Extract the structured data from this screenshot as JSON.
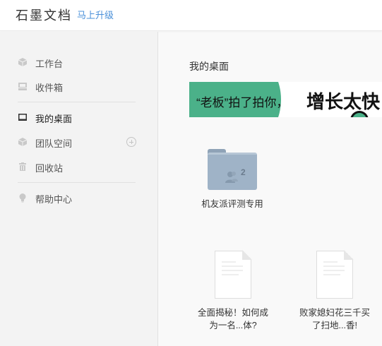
{
  "header": {
    "brand": "石墨文档",
    "upgrade_link": "马上升级"
  },
  "sidebar": {
    "items": [
      {
        "label": "工作台",
        "icon": "cube-icon"
      },
      {
        "label": "收件箱",
        "icon": "inbox-icon"
      },
      {
        "label": "我的桌面",
        "icon": "desktop-icon"
      },
      {
        "label": "团队空间",
        "icon": "team-cube-icon"
      },
      {
        "label": "回收站",
        "icon": "trash-icon"
      },
      {
        "label": "帮助中心",
        "icon": "lightbulb-icon"
      }
    ],
    "active": "我的桌面"
  },
  "main": {
    "title": "我的桌面",
    "banner": {
      "text_left": "“老板”拍了拍你，",
      "text_right": "增长太快"
    },
    "folder": {
      "name": "机友派评测专用",
      "member_count": "2"
    },
    "documents": [
      {
        "line1": "全面揭秘！如何成",
        "line2": "为一名...体?"
      },
      {
        "line1": "败家媳妇花三千买",
        "line2": "了扫地...香!"
      }
    ]
  },
  "colors": {
    "accent_green": "#4bb189",
    "link_blue": "#4a90d9",
    "folder_blue": "#9fb3c7"
  }
}
